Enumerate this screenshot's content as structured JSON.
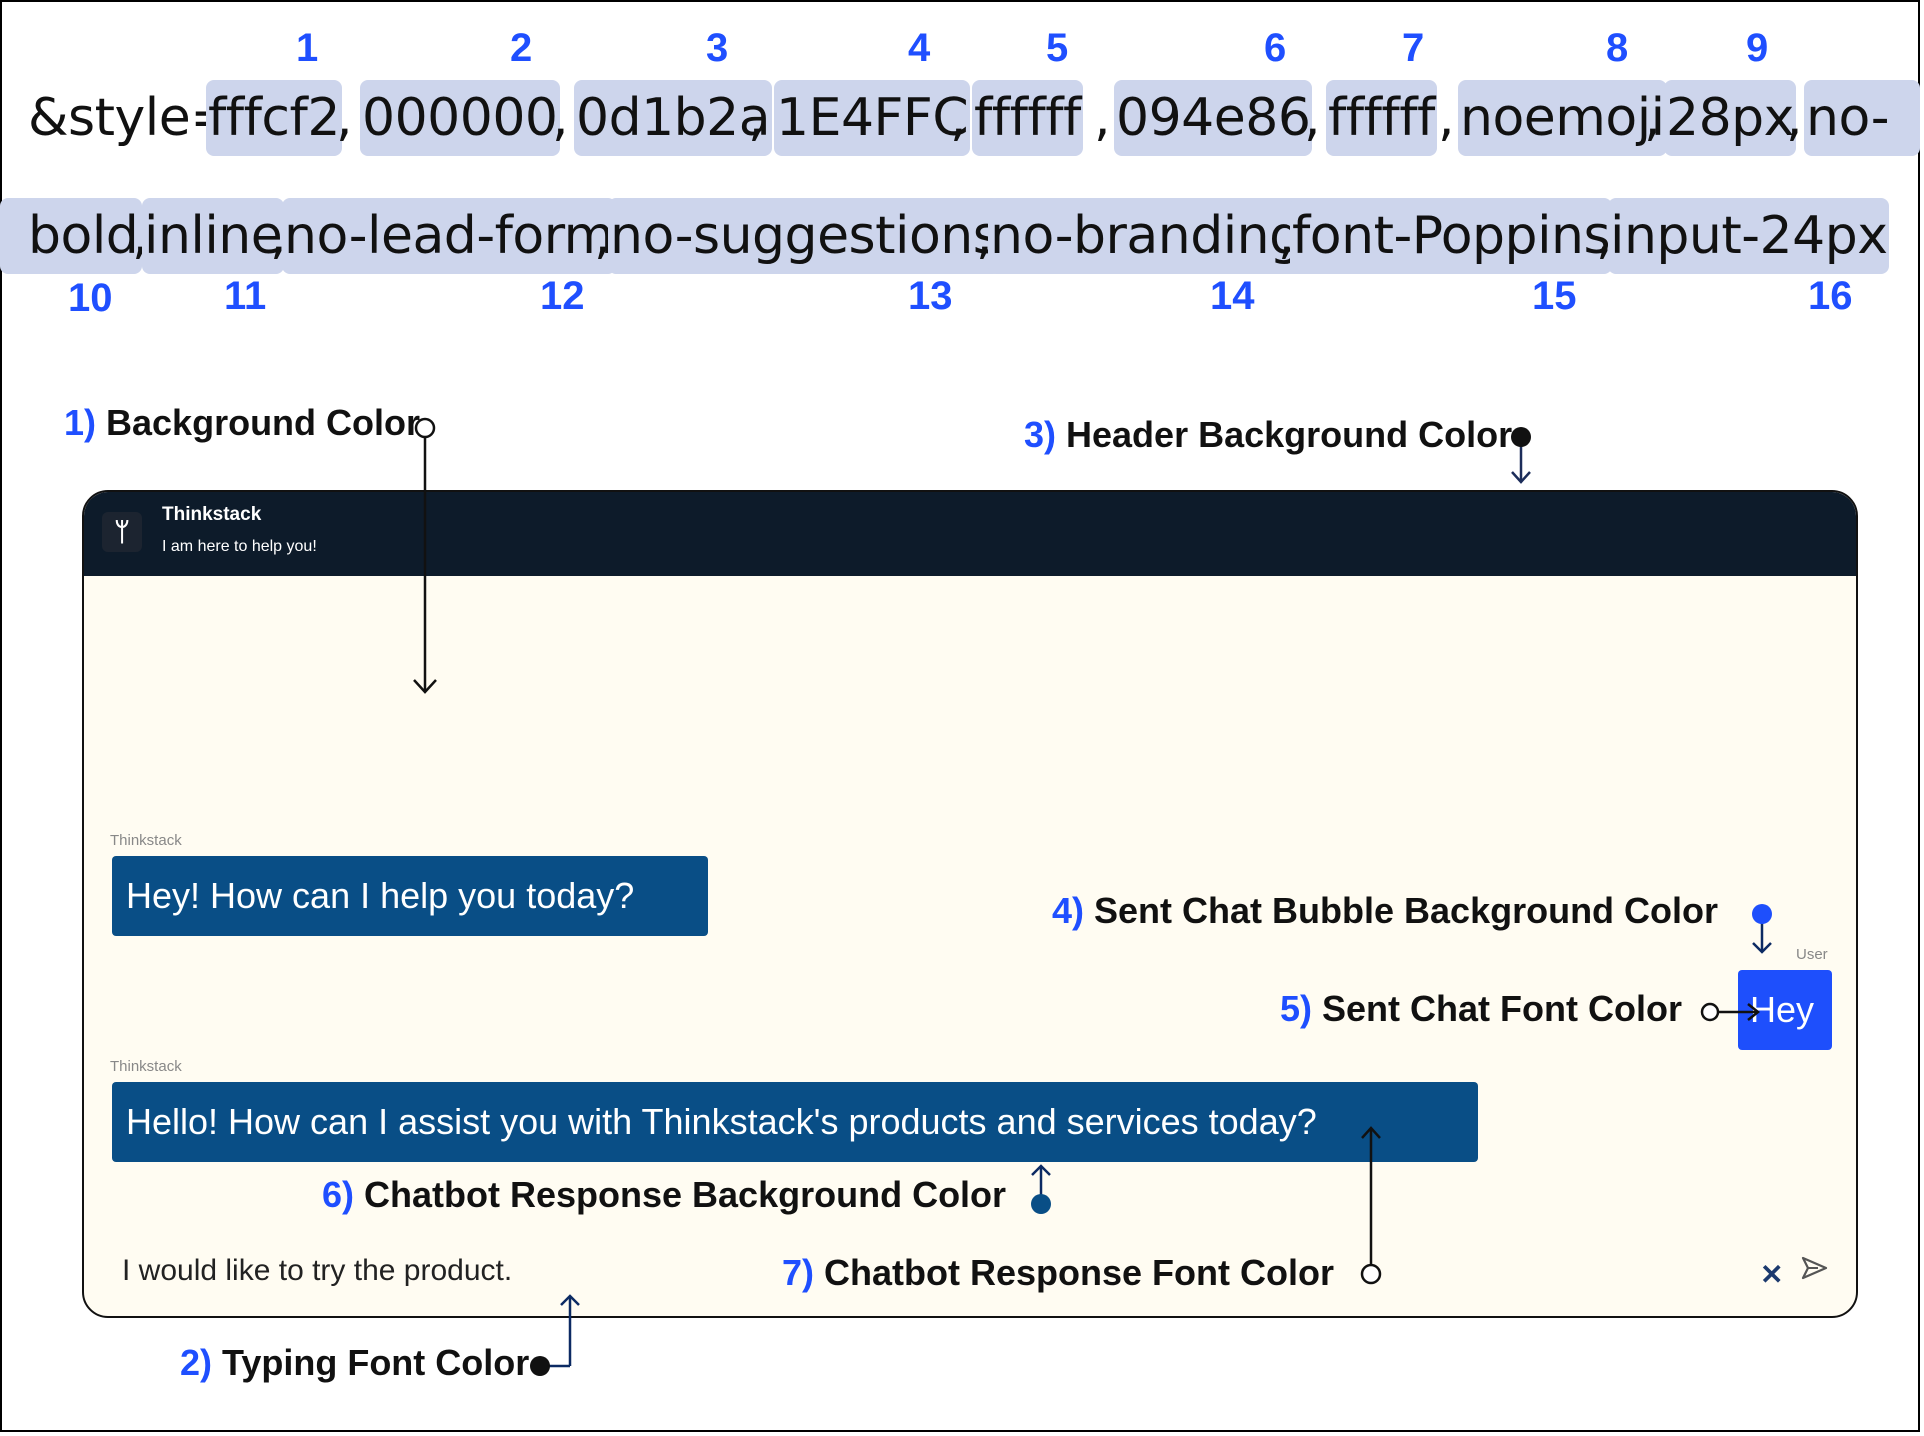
{
  "style_string": {
    "prefix": "&style=",
    "tokens": [
      {
        "num": "1",
        "text": "fffcf2"
      },
      {
        "num": "2",
        "text": "000000"
      },
      {
        "num": "3",
        "text": "0d1b2a"
      },
      {
        "num": "4",
        "text": "1E4FFC"
      },
      {
        "num": "5",
        "text": "ffffff"
      },
      {
        "num": "6",
        "text": "094e86"
      },
      {
        "num": "7",
        "text": "ffffff"
      },
      {
        "num": "8",
        "text": "noemoji"
      },
      {
        "num": "9",
        "text": "28px"
      },
      {
        "num": "10",
        "text": "no-bold"
      },
      {
        "num": "11",
        "text": "inline"
      },
      {
        "num": "12",
        "text": "no-lead-form"
      },
      {
        "num": "13",
        "text": "no-suggestions"
      },
      {
        "num": "14",
        "text": "no-branding"
      },
      {
        "num": "15",
        "text": "font-Poppins"
      },
      {
        "num": "16",
        "text": "input-24px"
      }
    ],
    "separators": [
      ",",
      ",",
      ",",
      ",",
      ",",
      ",",
      ",",
      ",",
      ","
    ]
  },
  "labels": {
    "bg": {
      "num": "1)",
      "text": "Background Color"
    },
    "typing": {
      "num": "2)",
      "text": "Typing Font Color"
    },
    "header": {
      "num": "3)",
      "text": "Header Background Color"
    },
    "sent_bg": {
      "num": "4)",
      "text": "Sent Chat Bubble Background Color"
    },
    "sent_font": {
      "num": "5)",
      "text": "Sent Chat Font Color"
    },
    "bot_bg": {
      "num": "6)",
      "text": "Chatbot Response Background Color"
    },
    "bot_font": {
      "num": "7)",
      "text": "Chatbot Response Font Color"
    }
  },
  "widget": {
    "header_title": "Thinkstack",
    "header_subtitle": "I am here to help you!",
    "bot_name": "Thinkstack",
    "user_name": "User",
    "messages": [
      {
        "from": "bot",
        "text": "Hey! How can I help you today?"
      },
      {
        "from": "user",
        "text": "Hey"
      },
      {
        "from": "bot",
        "text": "Hello! How can I assist you with Thinkstack's products and services today?"
      }
    ],
    "input_text": "I would like to try the product.",
    "close_glyph": "✕",
    "send_icon": "send-icon",
    "logo_glyph": "ᛘ"
  },
  "colors": {
    "background": "#fffcf2",
    "header": "#0d1b2a",
    "sent_bubble": "#1e4ffc",
    "bot_bubble": "#094e86",
    "accent_numbers": "#1f4fff",
    "highlight": "#cdd5ec"
  }
}
